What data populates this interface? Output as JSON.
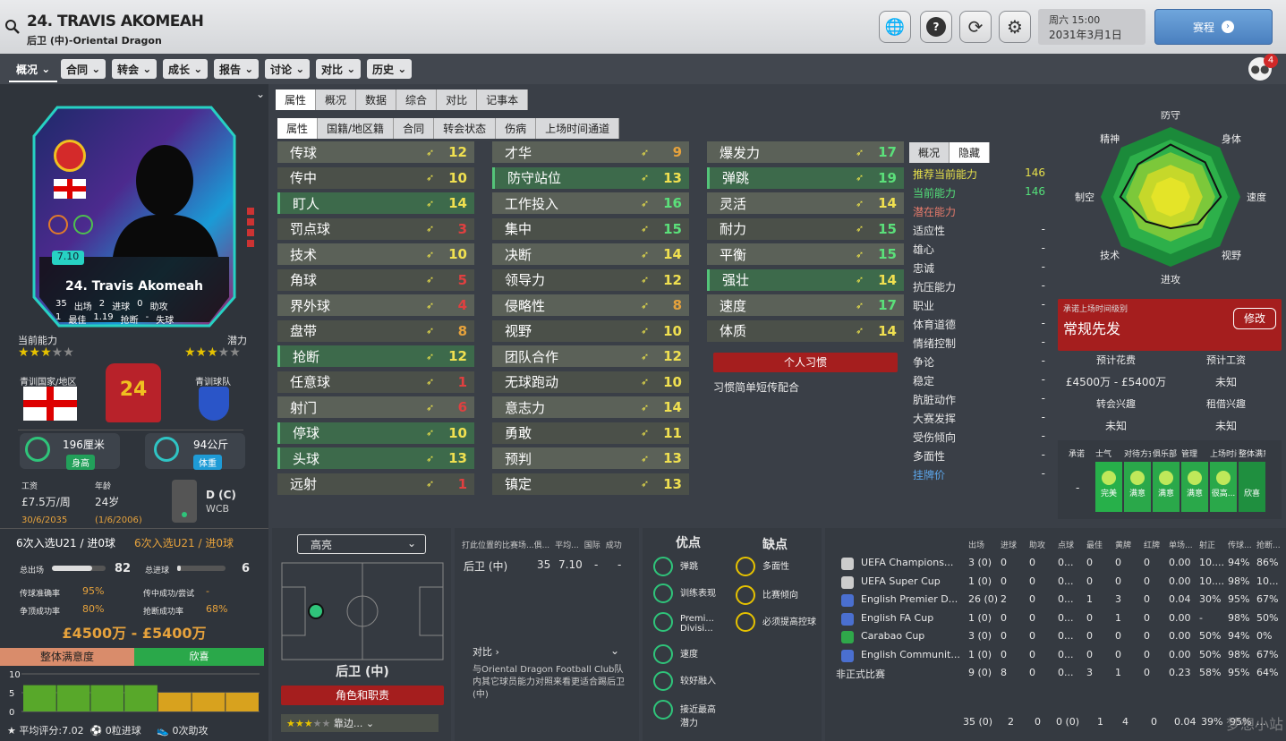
{
  "header": {
    "title": "24. TRAVIS AKOMEAH",
    "subtitle": "后卫 (中)-Oriental Dragon",
    "weekday_time": "周六 15:00",
    "date": "2031年3月1日",
    "schedule_label": "赛程"
  },
  "nav": {
    "overview": "概况",
    "items": [
      "合同",
      "转会",
      "成长",
      "报告",
      "讨论",
      "对比",
      "历史"
    ],
    "notifications": "4"
  },
  "card": {
    "rating": "7.10",
    "name": "24. Travis Akomeah",
    "stats": [
      [
        "35",
        "出场",
        "2",
        "进球",
        "0",
        "助攻"
      ],
      [
        "1",
        "最佳",
        "1.19",
        "抢断",
        "-",
        "失球"
      ]
    ],
    "current_ability_label": "当前能力",
    "potential_label": "潜力",
    "youth_nation_label": "青训国家/地区",
    "youth_club_label": "青训球队",
    "shirt_number": "24"
  },
  "physical": {
    "height": "196厘米",
    "height_tag": "身高",
    "weight": "94公斤",
    "weight_tag": "体重"
  },
  "contract": {
    "wage_label": "工资",
    "wage": "£7.5万/周",
    "wage_expiry": "30/6/2035",
    "age_label": "年龄",
    "age": "24岁",
    "dob": "(1/6/2006)",
    "position": "D (C)",
    "position_sub": "WCB"
  },
  "u21": {
    "left": "6次入选U21 / 进0球",
    "right": "6次入选U21 / 进0球"
  },
  "summary": {
    "apps_label": "总出场",
    "apps": "82",
    "goals_label": "总进球",
    "goals": "6",
    "pass_label": "传球准确率",
    "pass": "95%",
    "cross_label": "传中成功/尝试",
    "cross": "-",
    "header_label": "争顶成功率",
    "header": "80%",
    "tackle_label": "抢断成功率",
    "tackle": "68%",
    "value": "£4500万 - £5400万",
    "satisfaction_label": "整体满意度",
    "satisfaction": "欣喜"
  },
  "form": {
    "y_ticks": [
      "10",
      "5",
      "0"
    ],
    "values": [
      7,
      7,
      7,
      7,
      5,
      5,
      5
    ],
    "footer_avg": "平均评分:7.02",
    "footer_goals": "0粒进球",
    "footer_assists": "0次助攻"
  },
  "tabs_main": [
    "属性",
    "概况",
    "数据",
    "综合",
    "对比",
    "记事本"
  ],
  "tabs_sub": [
    "属性",
    "国籍/地区籍",
    "合同",
    "转会状态",
    "伤病",
    "上场时间通道"
  ],
  "attributes": {
    "col1": [
      [
        "传球",
        "12"
      ],
      [
        "传中",
        "10"
      ],
      [
        "盯人",
        "14"
      ],
      [
        "罚点球",
        "3"
      ],
      [
        "技术",
        "10"
      ],
      [
        "角球",
        "5"
      ],
      [
        "界外球",
        "4"
      ],
      [
        "盘带",
        "8"
      ],
      [
        "抢断",
        "12"
      ],
      [
        "任意球",
        "1"
      ],
      [
        "射门",
        "6"
      ],
      [
        "停球",
        "10"
      ],
      [
        "头球",
        "13"
      ],
      [
        "远射",
        "1"
      ]
    ],
    "col2": [
      [
        "才华",
        "9"
      ],
      [
        "防守站位",
        "13"
      ],
      [
        "工作投入",
        "16"
      ],
      [
        "集中",
        "15"
      ],
      [
        "决断",
        "14"
      ],
      [
        "领导力",
        "12"
      ],
      [
        "侵略性",
        "8"
      ],
      [
        "视野",
        "10"
      ],
      [
        "团队合作",
        "12"
      ],
      [
        "无球跑动",
        "10"
      ],
      [
        "意志力",
        "14"
      ],
      [
        "勇敢",
        "11"
      ],
      [
        "预判",
        "13"
      ],
      [
        "镇定",
        "13"
      ]
    ],
    "col3": [
      [
        "爆发力",
        "17"
      ],
      [
        "弹跳",
        "19"
      ],
      [
        "灵活",
        "14"
      ],
      [
        "耐力",
        "15"
      ],
      [
        "平衡",
        "15"
      ],
      [
        "强壮",
        "14"
      ],
      [
        "速度",
        "17"
      ],
      [
        "体质",
        "14"
      ]
    ]
  },
  "traits": {
    "button": "个人习惯",
    "item": "习惯简单短传配合"
  },
  "hidden": {
    "tabs": [
      "概况",
      "隐藏"
    ],
    "rec_label": "推荐当前能力",
    "rec": "146",
    "cur_label": "当前能力",
    "cur": "146",
    "pot_label": "潜在能力",
    "rows": [
      "适应性",
      "雄心",
      "忠诚",
      "抗压能力",
      "职业",
      "体育道德",
      "情绪控制",
      "争论",
      "稳定",
      "肮脏动作",
      "大赛发挥",
      "受伤倾向",
      "多面性",
      "挂牌价"
    ],
    "dash": "-"
  },
  "radar": {
    "labels": [
      "防守",
      "身体",
      "速度",
      "视野",
      "进攻",
      "技术",
      "制空",
      "精神"
    ]
  },
  "playing_time": {
    "label": "承诺上场时间级别",
    "value": "常规先发",
    "edit": "修改",
    "fee_label": "预计花费",
    "fee": "£4500万 - £5400万",
    "wage_label": "预计工资",
    "wage": "未知",
    "transfer_label": "转会兴趣",
    "transfer": "未知",
    "loan_label": "租借兴趣",
    "loan": "未知"
  },
  "happiness": {
    "headers": [
      "承诺",
      "士气",
      "对待方式",
      "俱乐部",
      "管理",
      "上场时间",
      "整体满意度"
    ],
    "promise": "-",
    "values": [
      "完美",
      "满意",
      "满意",
      "满意",
      "很高...",
      "欣喜"
    ]
  },
  "pitch": {
    "dropdown": "高亮",
    "position": "后卫 (中)",
    "role_button": "角色和职责",
    "role_sel": "靠边..."
  },
  "position_table": {
    "headers": [
      "打此位置的比赛场...俱...",
      "平均...",
      "国际",
      "成功"
    ],
    "row": [
      "后卫 (中)",
      "35",
      "7.10",
      "-",
      "-"
    ],
    "compare_label": "对比",
    "compare_text": "与Oriental Dragon Football Club队内其它球员能力对照来看更适合踢后卫 (中)"
  },
  "strengths": {
    "title": "优点",
    "items": [
      "弹跳",
      "训练表现",
      "Premi... Divisi...",
      "速度",
      "较好融入",
      "接近最高潜力"
    ]
  },
  "weaknesses": {
    "title": "缺点",
    "items": [
      "多面性",
      "比赛倾向",
      "必须提高控球"
    ]
  },
  "comp_stats": {
    "headers": [
      "出场",
      "进球",
      "助攻",
      "点球",
      "最佳",
      "黄牌",
      "红牌",
      "单场...",
      "射正",
      "传球...",
      "抢断..."
    ],
    "rows": [
      [
        "UEFA Champions...",
        "3 (0)",
        "0",
        "0",
        "0...",
        "0",
        "0",
        "0",
        "0.00",
        "10....",
        "94%",
        "86%"
      ],
      [
        "UEFA Super Cup",
        "1 (0)",
        "0",
        "0",
        "0...",
        "0",
        "0",
        "0",
        "0.00",
        "10....",
        "98%",
        "10..."
      ],
      [
        "English Premier D...",
        "26 (0)",
        "2",
        "0",
        "0...",
        "1",
        "3",
        "0",
        "0.04",
        "30%",
        "95%",
        "67%"
      ],
      [
        "English FA Cup",
        "1 (0)",
        "0",
        "0",
        "0...",
        "0",
        "1",
        "0",
        "0.00",
        "-",
        "98%",
        "50%"
      ],
      [
        "Carabao Cup",
        "3 (0)",
        "0",
        "0",
        "0...",
        "0",
        "0",
        "0",
        "0.00",
        "50%",
        "94%",
        "0%"
      ],
      [
        "English Communit...",
        "1 (0)",
        "0",
        "0",
        "0...",
        "0",
        "0",
        "0",
        "0.00",
        "50%",
        "98%",
        "67%"
      ],
      [
        "非正式比赛",
        "9 (0)",
        "8",
        "0",
        "0...",
        "3",
        "1",
        "0",
        "0.23",
        "58%",
        "95%",
        "64%"
      ]
    ],
    "total": [
      "35 (0)",
      "2",
      "0",
      "0 (0)",
      "1",
      "4",
      "0",
      "0.04",
      "39%",
      "95%",
      "..."
    ]
  },
  "watermark": "梦想小站"
}
